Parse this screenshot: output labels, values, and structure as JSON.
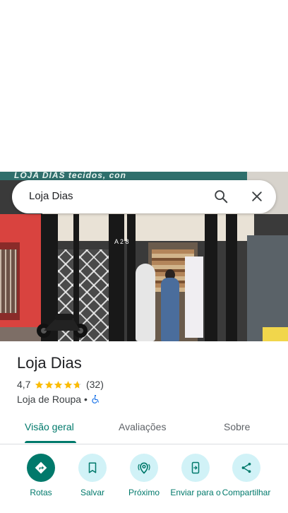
{
  "search": {
    "query": "Loja Dias"
  },
  "photo": {
    "sign_text": "LOJA DIAS  tecidos, con",
    "address_number": "A 2 8"
  },
  "place": {
    "name": "Loja Dias",
    "rating": "4,7",
    "stars": 4.7,
    "review_count": "(32)",
    "category": "Loja de Roupa •",
    "accessibility_icon": "wheelchair-icon"
  },
  "tabs": [
    {
      "label": "Visão geral",
      "active": true
    },
    {
      "label": "Avaliações",
      "active": false
    },
    {
      "label": "Sobre",
      "active": false
    }
  ],
  "actions": [
    {
      "label": "Rotas",
      "icon": "directions-icon"
    },
    {
      "label": "Salvar",
      "icon": "bookmark-icon"
    },
    {
      "label": "Próximo",
      "icon": "nearby-icon"
    },
    {
      "label": "Enviar para o",
      "icon": "send-to-phone-icon"
    },
    {
      "label": "Compartilhar",
      "icon": "share-icon"
    }
  ],
  "colors": {
    "accent": "#00796b",
    "action_bg": "#d1f2f7",
    "star": "#fbbc04"
  }
}
